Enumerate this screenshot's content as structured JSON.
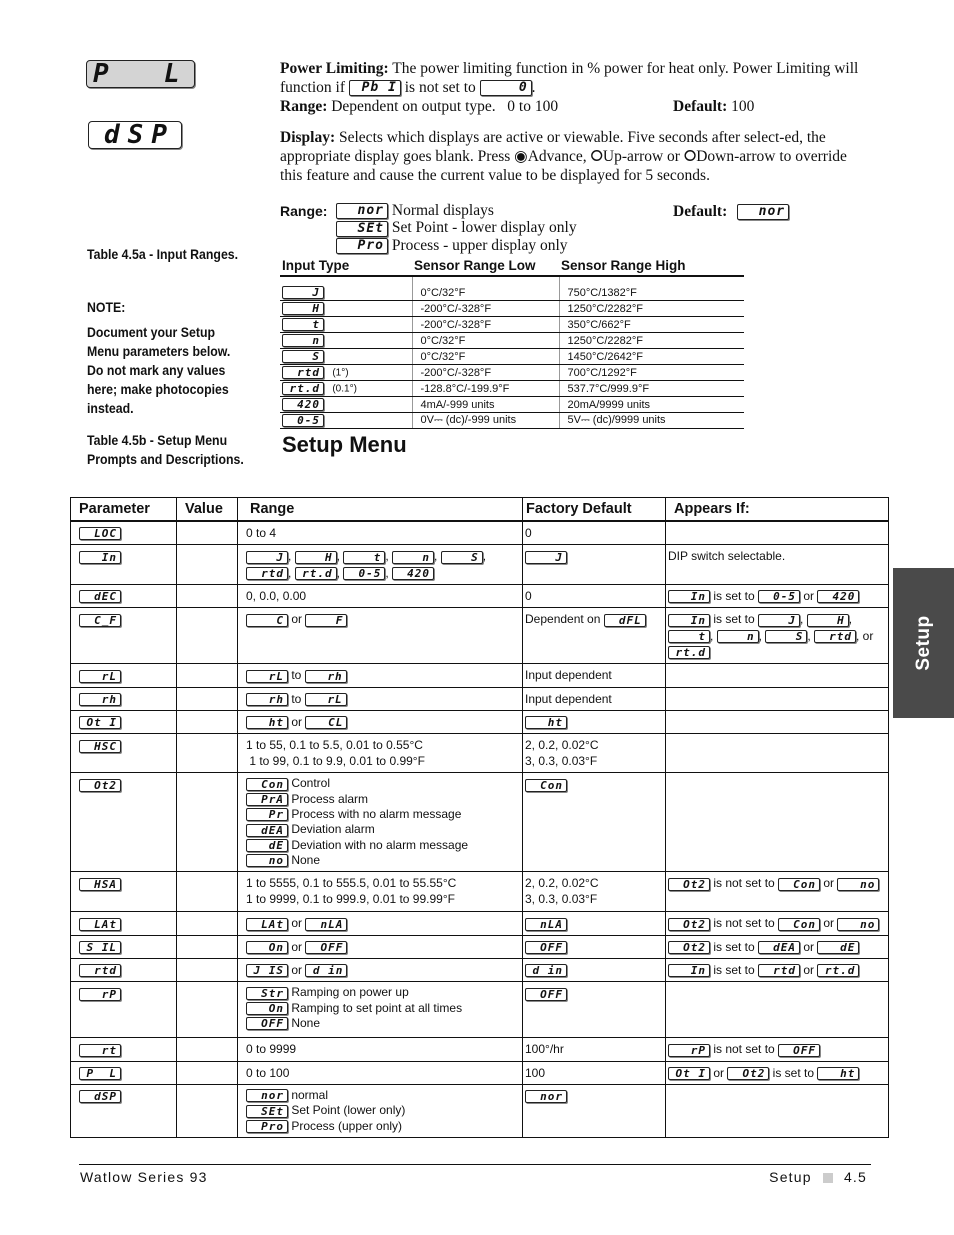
{
  "prompts": {
    "pl": {
      "display": "P  L",
      "title": "Power Limiting:",
      "text1": "The power limiting function in % power for heat only. Power Limiting will function if",
      "ref1": "Pb I",
      "text2": "is not set to",
      "ref2": "0",
      "text3": ".",
      "range_label": "Range:",
      "range": "Dependent on output type.   0 to 100",
      "default_label": "Default:",
      "default": "100"
    },
    "dsp": {
      "display": "dSP",
      "title": "Display:",
      "text": "Selects which displays are active or viewable. Five seconds after select-ed, the appropriate display goes blank. Press ◉Advance, ⭘Up-arrow or ⭘Down-arrow to override this feature and cause the current value to be displayed for 5 seconds.",
      "range_label": "Range:",
      "default_label": "Default:",
      "default": "nor",
      "options": [
        {
          "code": "nor",
          "label": "Normal displays"
        },
        {
          "code": "SEt",
          "label": "Set Point - lower display only"
        },
        {
          "code": "Pro",
          "label": "Process - upper display only"
        }
      ]
    }
  },
  "side_notes": {
    "table_a": "Table 4.5a - Input Ranges.",
    "note_title": "NOTE:",
    "note_body": "Document your Setup Menu parameters below. Do not mark any values here; make photocopies instead.",
    "table_b": "Table 4.5b - Setup Menu Prompts and Descriptions."
  },
  "input_ranges": {
    "headers": [
      "Input Type",
      "Sensor Range Low",
      "Sensor Range High"
    ],
    "rows": [
      {
        "code": "J",
        "note": "",
        "low": "0°C/32°F",
        "high": "750°C/1382°F"
      },
      {
        "code": "H",
        "note": "",
        "low": "-200°C/-328°F",
        "high": "1250°C/2282°F"
      },
      {
        "code": "t",
        "note": "",
        "low": "-200°C/-328°F",
        "high": "350°C/662°F"
      },
      {
        "code": "n",
        "note": "",
        "low": "0°C/32°F",
        "high": "1250°C/2282°F"
      },
      {
        "code": "S",
        "note": "",
        "low": "0°C/32°F",
        "high": "1450°C/2642°F"
      },
      {
        "code": "rtd",
        "note": "(1°)",
        "low": "-200°C/-328°F",
        "high": "700°C/1292°F"
      },
      {
        "code": "rt.d",
        "note": "(0.1°)",
        "low": "-128.8°C/-199.9°F",
        "high": "537.7°C/999.9°F"
      },
      {
        "code": "420",
        "note": "",
        "low": "4mA/-999 units",
        "high": "20mA/9999 units"
      },
      {
        "code": "0-5",
        "note": "",
        "low": "0V⎓ (dc)/-999 units",
        "high": "5V⎓ (dc)/9999 units"
      }
    ]
  },
  "setup_menu": {
    "title": "Setup Menu",
    "headers": [
      "Parameter",
      "Value",
      "Range",
      "Factory Default",
      "Appears If:"
    ],
    "rows": [
      {
        "param": "LOC",
        "range": [
          {
            "t": "0 to 4"
          }
        ],
        "default": [
          {
            "t": "0"
          }
        ],
        "appears": []
      },
      {
        "param": "In",
        "range": [
          {
            "c": "J"
          },
          {
            "t": ", "
          },
          {
            "c": "H"
          },
          {
            "t": ", "
          },
          {
            "c": "t"
          },
          {
            "t": ", "
          },
          {
            "c": "n"
          },
          {
            "t": ", "
          },
          {
            "c": "S"
          },
          {
            "t": ","
          },
          {
            "br": 1
          },
          {
            "c": "rtd"
          },
          {
            "t": ", "
          },
          {
            "c": "rt.d"
          },
          {
            "t": ", "
          },
          {
            "c": "0-5"
          },
          {
            "t": ", "
          },
          {
            "c": "420"
          }
        ],
        "default": [
          {
            "c": "J"
          }
        ],
        "appears": [
          {
            "t": "DIP switch selectable."
          }
        ]
      },
      {
        "param": "dEC",
        "range": [
          {
            "t": "0, 0.0, 0.00"
          }
        ],
        "default": [
          {
            "t": "0"
          }
        ],
        "appears": [
          {
            "c": "In"
          },
          {
            "t": " is set to "
          },
          {
            "c": "0-5"
          },
          {
            "t": " or "
          },
          {
            "c": "420"
          }
        ]
      },
      {
        "param": "C_F",
        "range": [
          {
            "c": "C"
          },
          {
            "t": " or "
          },
          {
            "c": "F"
          }
        ],
        "default": [
          {
            "t": "Dependent on "
          },
          {
            "c": "dFL"
          }
        ],
        "appears": [
          {
            "c": "In"
          },
          {
            "t": " is set to "
          },
          {
            "c": "J"
          },
          {
            "t": ", "
          },
          {
            "c": "H"
          },
          {
            "t": ","
          },
          {
            "br": 1
          },
          {
            "c": "t"
          },
          {
            "t": ", "
          },
          {
            "c": "n"
          },
          {
            "t": ", "
          },
          {
            "c": "S"
          },
          {
            "t": ", "
          },
          {
            "c": "rtd"
          },
          {
            "t": ", or"
          },
          {
            "br": 1
          },
          {
            "c": "rt.d"
          }
        ]
      },
      {
        "param": "rL",
        "range": [
          {
            "c": "rL"
          },
          {
            "t": " to "
          },
          {
            "c": "rh"
          }
        ],
        "default": [
          {
            "t": "Input dependent"
          }
        ],
        "appears": []
      },
      {
        "param": "rh",
        "range": [
          {
            "c": "rh"
          },
          {
            "t": " to "
          },
          {
            "c": "rL"
          }
        ],
        "default": [
          {
            "t": "Input dependent"
          }
        ],
        "appears": []
      },
      {
        "param": "Ot I",
        "range": [
          {
            "c": "ht"
          },
          {
            "t": " or "
          },
          {
            "c": "CL"
          }
        ],
        "default": [
          {
            "c": "ht"
          }
        ],
        "appears": []
      },
      {
        "param": "HSC",
        "range": [
          {
            "t": "1 to 55, 0.1 to 5.5, 0.01 to 0.55°C"
          },
          {
            "br": 1
          },
          {
            "t": " 1 to 99, 0.1 to 9.9, 0.01 to 0.99°F"
          }
        ],
        "default": [
          {
            "t": "2, 0.2, 0.02°C"
          },
          {
            "br": 1
          },
          {
            "t": "3, 0.3, 0.03°F"
          }
        ],
        "appears": []
      },
      {
        "param": "Ot2",
        "range": [
          {
            "o": "Con",
            "l": "Control"
          },
          {
            "o": "PrA",
            "l": "Process alarm"
          },
          {
            "o": "Pr",
            "l": "Process with no alarm message"
          },
          {
            "o": "dEA",
            "l": "Deviation alarm"
          },
          {
            "o": "dE",
            "l": "Deviation with no alarm message"
          },
          {
            "o": "no",
            "l": "None"
          }
        ],
        "default": [
          {
            "c": "Con"
          }
        ],
        "appears": []
      },
      {
        "param": "HSA",
        "range": [
          {
            "t": "1 to 5555, 0.1 to 555.5, 0.01 to 55.55°C"
          },
          {
            "br": 1
          },
          {
            "t": "1 to 9999, 0.1 to 999.9, 0.01 to 99.99°F"
          }
        ],
        "default": [
          {
            "t": "2, 0.2, 0.02°C"
          },
          {
            "br": 1
          },
          {
            "t": "3, 0.3, 0.03°F"
          }
        ],
        "appears": [
          {
            "c": "Ot2"
          },
          {
            "t": " is not set to "
          },
          {
            "c": "Con"
          },
          {
            "t": " or "
          },
          {
            "c": "no"
          }
        ]
      },
      {
        "param": "LAt",
        "range": [
          {
            "c": "LAt"
          },
          {
            "t": " or "
          },
          {
            "c": "nLA"
          }
        ],
        "default": [
          {
            "c": "nLA"
          }
        ],
        "appears": [
          {
            "c": "Ot2"
          },
          {
            "t": " is not set to "
          },
          {
            "c": "Con"
          },
          {
            "t": " or "
          },
          {
            "c": "no"
          }
        ]
      },
      {
        "param": "S IL",
        "range": [
          {
            "c": "On"
          },
          {
            "t": " or "
          },
          {
            "c": "OFF"
          }
        ],
        "default": [
          {
            "c": "OFF"
          }
        ],
        "appears": [
          {
            "c": "Ot2"
          },
          {
            "t": " is set to "
          },
          {
            "c": "dEA"
          },
          {
            "t": " or "
          },
          {
            "c": "dE"
          }
        ]
      },
      {
        "param": "rtd",
        "range": [
          {
            "c": "J IS"
          },
          {
            "t": " or "
          },
          {
            "c": "d in"
          }
        ],
        "default": [
          {
            "c": "d in"
          }
        ],
        "appears": [
          {
            "c": "In"
          },
          {
            "t": " is set to "
          },
          {
            "c": "rtd"
          },
          {
            "t": " or "
          },
          {
            "c": "rt.d"
          }
        ]
      },
      {
        "param": "rP",
        "range": [
          {
            "o": "Str",
            "l": "Ramping on power up"
          },
          {
            "o": "On",
            "l": "Ramping to set point at all times"
          },
          {
            "o": "OFF",
            "l": "None"
          }
        ],
        "default": [
          {
            "c": "OFF"
          }
        ],
        "appears": []
      },
      {
        "param": "rt",
        "range": [
          {
            "t": "0 to 9999"
          }
        ],
        "default": [
          {
            "t": "100°/hr"
          }
        ],
        "appears": [
          {
            "c": "rP"
          },
          {
            "t": " is not set to "
          },
          {
            "c": "OFF"
          }
        ]
      },
      {
        "param": "P  L",
        "range": [
          {
            "t": "0 to 100"
          }
        ],
        "default": [
          {
            "t": "100"
          }
        ],
        "appears": [
          {
            "c": "Ot I"
          },
          {
            "t": " or "
          },
          {
            "c": "Ot2"
          },
          {
            "t": " is set to "
          },
          {
            "c": "ht"
          }
        ]
      },
      {
        "param": "dSP",
        "range": [
          {
            "o": "nor",
            "l": "normal"
          },
          {
            "o": "SEt",
            "l": "Set Point (lower only)"
          },
          {
            "o": "Pro",
            "l": "Process (upper only)"
          }
        ],
        "default": [
          {
            "c": "nor"
          }
        ],
        "appears": []
      }
    ]
  },
  "side_tab": "Setup",
  "footer": {
    "left": "Watlow Series 93",
    "right_section": "Setup",
    "page": "4.5"
  }
}
